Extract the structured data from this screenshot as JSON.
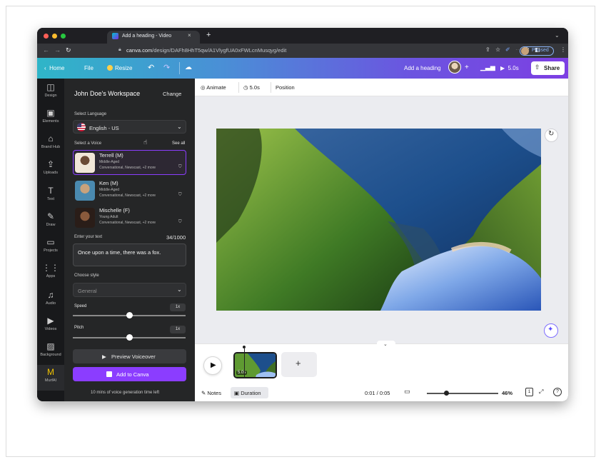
{
  "browser": {
    "tab_title": "Add a heading - Video",
    "tab_close": "×",
    "new_tab": "+",
    "url_domain": "canva.com",
    "url_path": "/design/DAFh8HhT5qw/A1VlygfUA0xFWLcnMusqyg/edit",
    "profile_status": "Paused"
  },
  "header": {
    "home_label": "Home",
    "file_label": "File",
    "resize_label": "Resize",
    "design_title": "Add a heading",
    "play_duration": "5.0s",
    "share_label": "Share"
  },
  "rail": {
    "items": [
      {
        "label": "Design",
        "icon": "design-icon",
        "glyph": "◫"
      },
      {
        "label": "Elements",
        "icon": "elements-icon",
        "glyph": "▣"
      },
      {
        "label": "Brand Hub",
        "icon": "brand-hub-icon",
        "glyph": "⌂"
      },
      {
        "label": "Uploads",
        "icon": "uploads-icon",
        "glyph": "⇪"
      },
      {
        "label": "Text",
        "icon": "text-icon",
        "glyph": "T"
      },
      {
        "label": "Draw",
        "icon": "draw-icon",
        "glyph": "✎"
      },
      {
        "label": "Projects",
        "icon": "projects-icon",
        "glyph": "▭"
      },
      {
        "label": "Apps",
        "icon": "apps-icon",
        "glyph": "⋮⋮"
      },
      {
        "label": "Audio",
        "icon": "audio-icon",
        "glyph": "♫"
      },
      {
        "label": "Videos",
        "icon": "videos-icon",
        "glyph": "▶"
      },
      {
        "label": "Background",
        "icon": "background-icon",
        "glyph": "▨"
      },
      {
        "label": "MurfAI",
        "icon": "murfai-icon",
        "glyph": "M"
      }
    ]
  },
  "panel": {
    "workspace_title": "John Doe's Workspace",
    "change_label": "Change",
    "language_heading": "Select Language",
    "language_value": "English - US",
    "voice_heading": "Select a Voice",
    "see_all": "See all",
    "voices": [
      {
        "name": "Terrell (M)",
        "age": "Middle-Aged",
        "styles": "Conversational, Newscast, +2 more",
        "selected": true
      },
      {
        "name": "Ken (M)",
        "age": "Middle-Aged",
        "styles": "Conversational, Newscast, +2 more",
        "selected": false
      },
      {
        "name": "Mischelle (F)",
        "age": "Young Adult",
        "styles": "Conversational, Newscast, +2 more",
        "selected": false
      }
    ],
    "text_heading": "Enter your text",
    "char_count": "34/1000",
    "text_value": "Once upon a time, there was a fox.",
    "style_heading": "Choose style",
    "style_value": "General",
    "speed_label": "Speed",
    "speed_value": "1x",
    "speed_level": 0.5,
    "pitch_label": "Pitch",
    "pitch_value": "1x",
    "pitch_level": 0.5,
    "preview_label": "Preview Voiceover",
    "add_label": "Add to Canva",
    "remaining": "10 mins of voice generation time left"
  },
  "toolbar": {
    "animate_label": "Animate",
    "duration_label": "5.0s",
    "position_label": "Position"
  },
  "timeline": {
    "clip_duration": "5.0s",
    "add_clip": "+"
  },
  "footer": {
    "notes_label": "Notes",
    "duration_label": "Duration",
    "time_readout": "0:01 / 0:05",
    "zoom_percent": "46%",
    "page_count": "1",
    "help": "?"
  }
}
